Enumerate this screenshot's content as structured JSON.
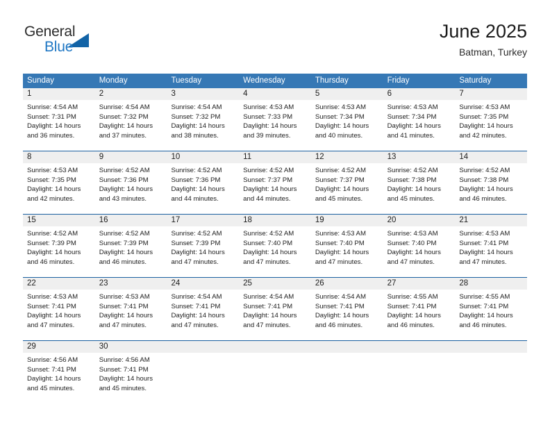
{
  "brand": {
    "name_part1": "General",
    "name_part2": "Blue",
    "logo_icon": "triangle-logo-icon",
    "accent_color": "#1263a6",
    "blue_text_color": "#1f77c4"
  },
  "header": {
    "title": "June 2025",
    "subtitle": "Batman, Turkey"
  },
  "theme": {
    "header_row_bg": "#3678b5",
    "week_separator": "#1a5fa0",
    "day_number_bg": "#efefef",
    "cell_bg": "#ffffff",
    "text_color": "#1c1c1c"
  },
  "weekdays": [
    "Sunday",
    "Monday",
    "Tuesday",
    "Wednesday",
    "Thursday",
    "Friday",
    "Saturday"
  ],
  "weeks": [
    {
      "days": [
        {
          "number": "1",
          "sunrise": "Sunrise: 4:54 AM",
          "sunset": "Sunset: 7:31 PM",
          "daylight": "Daylight: 14 hours and 36 minutes."
        },
        {
          "number": "2",
          "sunrise": "Sunrise: 4:54 AM",
          "sunset": "Sunset: 7:32 PM",
          "daylight": "Daylight: 14 hours and 37 minutes."
        },
        {
          "number": "3",
          "sunrise": "Sunrise: 4:54 AM",
          "sunset": "Sunset: 7:32 PM",
          "daylight": "Daylight: 14 hours and 38 minutes."
        },
        {
          "number": "4",
          "sunrise": "Sunrise: 4:53 AM",
          "sunset": "Sunset: 7:33 PM",
          "daylight": "Daylight: 14 hours and 39 minutes."
        },
        {
          "number": "5",
          "sunrise": "Sunrise: 4:53 AM",
          "sunset": "Sunset: 7:34 PM",
          "daylight": "Daylight: 14 hours and 40 minutes."
        },
        {
          "number": "6",
          "sunrise": "Sunrise: 4:53 AM",
          "sunset": "Sunset: 7:34 PM",
          "daylight": "Daylight: 14 hours and 41 minutes."
        },
        {
          "number": "7",
          "sunrise": "Sunrise: 4:53 AM",
          "sunset": "Sunset: 7:35 PM",
          "daylight": "Daylight: 14 hours and 42 minutes."
        }
      ]
    },
    {
      "days": [
        {
          "number": "8",
          "sunrise": "Sunrise: 4:53 AM",
          "sunset": "Sunset: 7:35 PM",
          "daylight": "Daylight: 14 hours and 42 minutes."
        },
        {
          "number": "9",
          "sunrise": "Sunrise: 4:52 AM",
          "sunset": "Sunset: 7:36 PM",
          "daylight": "Daylight: 14 hours and 43 minutes."
        },
        {
          "number": "10",
          "sunrise": "Sunrise: 4:52 AM",
          "sunset": "Sunset: 7:36 PM",
          "daylight": "Daylight: 14 hours and 44 minutes."
        },
        {
          "number": "11",
          "sunrise": "Sunrise: 4:52 AM",
          "sunset": "Sunset: 7:37 PM",
          "daylight": "Daylight: 14 hours and 44 minutes."
        },
        {
          "number": "12",
          "sunrise": "Sunrise: 4:52 AM",
          "sunset": "Sunset: 7:37 PM",
          "daylight": "Daylight: 14 hours and 45 minutes."
        },
        {
          "number": "13",
          "sunrise": "Sunrise: 4:52 AM",
          "sunset": "Sunset: 7:38 PM",
          "daylight": "Daylight: 14 hours and 45 minutes."
        },
        {
          "number": "14",
          "sunrise": "Sunrise: 4:52 AM",
          "sunset": "Sunset: 7:38 PM",
          "daylight": "Daylight: 14 hours and 46 minutes."
        }
      ]
    },
    {
      "days": [
        {
          "number": "15",
          "sunrise": "Sunrise: 4:52 AM",
          "sunset": "Sunset: 7:39 PM",
          "daylight": "Daylight: 14 hours and 46 minutes."
        },
        {
          "number": "16",
          "sunrise": "Sunrise: 4:52 AM",
          "sunset": "Sunset: 7:39 PM",
          "daylight": "Daylight: 14 hours and 46 minutes."
        },
        {
          "number": "17",
          "sunrise": "Sunrise: 4:52 AM",
          "sunset": "Sunset: 7:39 PM",
          "daylight": "Daylight: 14 hours and 47 minutes."
        },
        {
          "number": "18",
          "sunrise": "Sunrise: 4:52 AM",
          "sunset": "Sunset: 7:40 PM",
          "daylight": "Daylight: 14 hours and 47 minutes."
        },
        {
          "number": "19",
          "sunrise": "Sunrise: 4:53 AM",
          "sunset": "Sunset: 7:40 PM",
          "daylight": "Daylight: 14 hours and 47 minutes."
        },
        {
          "number": "20",
          "sunrise": "Sunrise: 4:53 AM",
          "sunset": "Sunset: 7:40 PM",
          "daylight": "Daylight: 14 hours and 47 minutes."
        },
        {
          "number": "21",
          "sunrise": "Sunrise: 4:53 AM",
          "sunset": "Sunset: 7:41 PM",
          "daylight": "Daylight: 14 hours and 47 minutes."
        }
      ]
    },
    {
      "days": [
        {
          "number": "22",
          "sunrise": "Sunrise: 4:53 AM",
          "sunset": "Sunset: 7:41 PM",
          "daylight": "Daylight: 14 hours and 47 minutes."
        },
        {
          "number": "23",
          "sunrise": "Sunrise: 4:53 AM",
          "sunset": "Sunset: 7:41 PM",
          "daylight": "Daylight: 14 hours and 47 minutes."
        },
        {
          "number": "24",
          "sunrise": "Sunrise: 4:54 AM",
          "sunset": "Sunset: 7:41 PM",
          "daylight": "Daylight: 14 hours and 47 minutes."
        },
        {
          "number": "25",
          "sunrise": "Sunrise: 4:54 AM",
          "sunset": "Sunset: 7:41 PM",
          "daylight": "Daylight: 14 hours and 47 minutes."
        },
        {
          "number": "26",
          "sunrise": "Sunrise: 4:54 AM",
          "sunset": "Sunset: 7:41 PM",
          "daylight": "Daylight: 14 hours and 46 minutes."
        },
        {
          "number": "27",
          "sunrise": "Sunrise: 4:55 AM",
          "sunset": "Sunset: 7:41 PM",
          "daylight": "Daylight: 14 hours and 46 minutes."
        },
        {
          "number": "28",
          "sunrise": "Sunrise: 4:55 AM",
          "sunset": "Sunset: 7:41 PM",
          "daylight": "Daylight: 14 hours and 46 minutes."
        }
      ]
    },
    {
      "days": [
        {
          "number": "29",
          "sunrise": "Sunrise: 4:56 AM",
          "sunset": "Sunset: 7:41 PM",
          "daylight": "Daylight: 14 hours and 45 minutes."
        },
        {
          "number": "30",
          "sunrise": "Sunrise: 4:56 AM",
          "sunset": "Sunset: 7:41 PM",
          "daylight": "Daylight: 14 hours and 45 minutes."
        },
        {
          "number": "",
          "sunrise": "",
          "sunset": "",
          "daylight": ""
        },
        {
          "number": "",
          "sunrise": "",
          "sunset": "",
          "daylight": ""
        },
        {
          "number": "",
          "sunrise": "",
          "sunset": "",
          "daylight": ""
        },
        {
          "number": "",
          "sunrise": "",
          "sunset": "",
          "daylight": ""
        },
        {
          "number": "",
          "sunrise": "",
          "sunset": "",
          "daylight": ""
        }
      ]
    }
  ]
}
